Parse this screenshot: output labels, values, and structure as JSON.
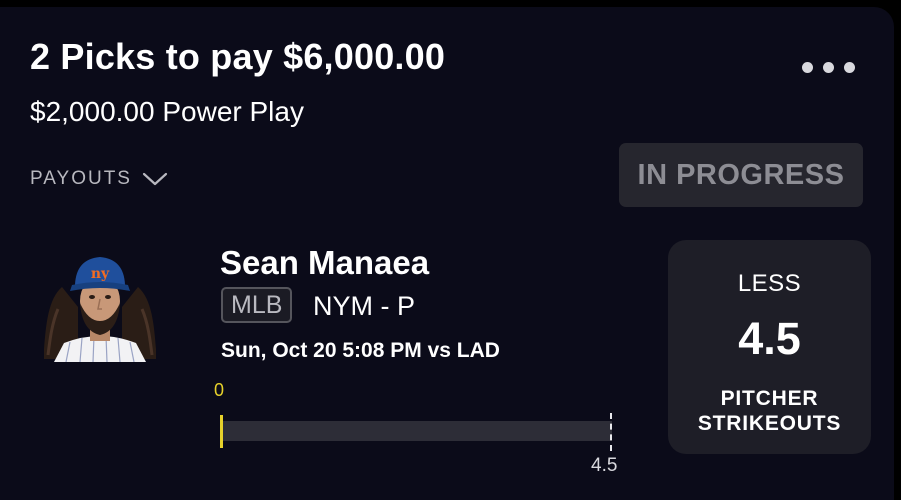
{
  "header": {
    "title": "2 Picks to pay $6,000.00",
    "subtitle": "$2,000.00 Power Play",
    "more_icon": "more-horizontal-icon"
  },
  "payouts": {
    "label": "PAYOUTS",
    "icon": "chevron-down-icon"
  },
  "status": {
    "label": "IN PROGRESS"
  },
  "pick": {
    "player_name": "Sean Manaea",
    "league": "MLB",
    "team_position": "NYM - P",
    "game_time": "Sun, Oct 20 5:08 PM  vs LAD",
    "progress": {
      "current": "0",
      "target": "4.5",
      "fraction": 0
    },
    "direction": "LESS",
    "line": "4.5",
    "stat_line1": "PITCHER",
    "stat_line2": "STRIKEOUTS"
  },
  "colors": {
    "background": "#0b0b19",
    "accent_yellow": "#e6d12b",
    "badge_bg": "#26262e",
    "pick_box_bg": "#1e1e27",
    "mets_blue": "#1f4f9c",
    "mets_orange": "#f26c22"
  }
}
